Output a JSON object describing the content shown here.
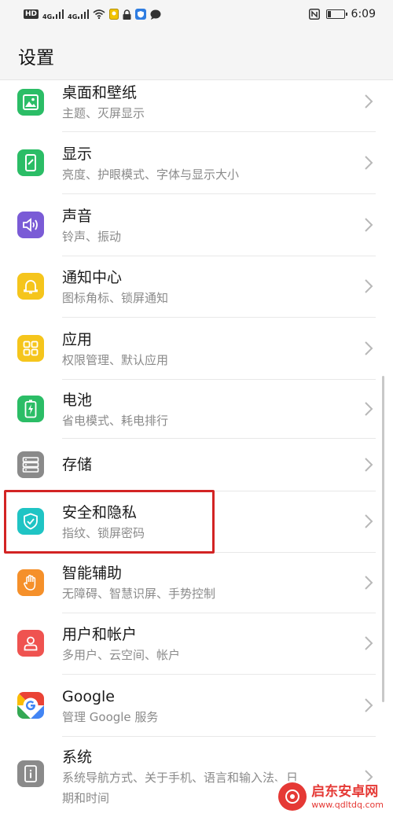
{
  "status_bar": {
    "left_labels": {
      "hd": "HD",
      "net1": "4G",
      "net2": "4G"
    },
    "time": "6:09",
    "battery_level": 0.2
  },
  "header": {
    "title": "设置"
  },
  "items": [
    {
      "title": "桌面和壁纸",
      "subtitle": "主题、灭屏显示",
      "icon": "wallpaper-icon",
      "color": "#2bbd66"
    },
    {
      "title": "显示",
      "subtitle": "亮度、护眼模式、字体与显示大小",
      "icon": "display-icon",
      "color": "#2bbd66"
    },
    {
      "title": "声音",
      "subtitle": "铃声、振动",
      "icon": "sound-icon",
      "color": "#7a5bd6"
    },
    {
      "title": "通知中心",
      "subtitle": "图标角标、锁屏通知",
      "icon": "bell-icon",
      "color": "#f5c51c"
    },
    {
      "title": "应用",
      "subtitle": "权限管理、默认应用",
      "icon": "apps-icon",
      "color": "#f5c51c"
    },
    {
      "title": "电池",
      "subtitle": "省电模式、耗电排行",
      "icon": "battery-icon",
      "color": "#2bbd66"
    },
    {
      "title": "存储",
      "subtitle": "",
      "icon": "storage-icon",
      "color": "#8a8a8a"
    },
    {
      "title": "安全和隐私",
      "subtitle": "指纹、锁屏密码",
      "icon": "shield-icon",
      "color": "#1fc4c4"
    },
    {
      "title": "智能辅助",
      "subtitle": "无障碍、智慧识屏、手势控制",
      "icon": "hand-icon",
      "color": "#f5902a"
    },
    {
      "title": "用户和帐户",
      "subtitle": "多用户、云空间、帐户",
      "icon": "user-icon",
      "color": "#ef5350"
    },
    {
      "title": "Google",
      "subtitle": "管理 Google 服务",
      "icon": "google-icon",
      "color": "#ffffff"
    },
    {
      "title": "系统",
      "subtitle": "系统导航方式、关于手机、语言和输入法、日",
      "subtitle2": "期和时间",
      "icon": "system-icon",
      "color": "#8a8a8a"
    }
  ],
  "watermark": {
    "name": "启东安卓网",
    "url": "www.qdltdq.com"
  }
}
